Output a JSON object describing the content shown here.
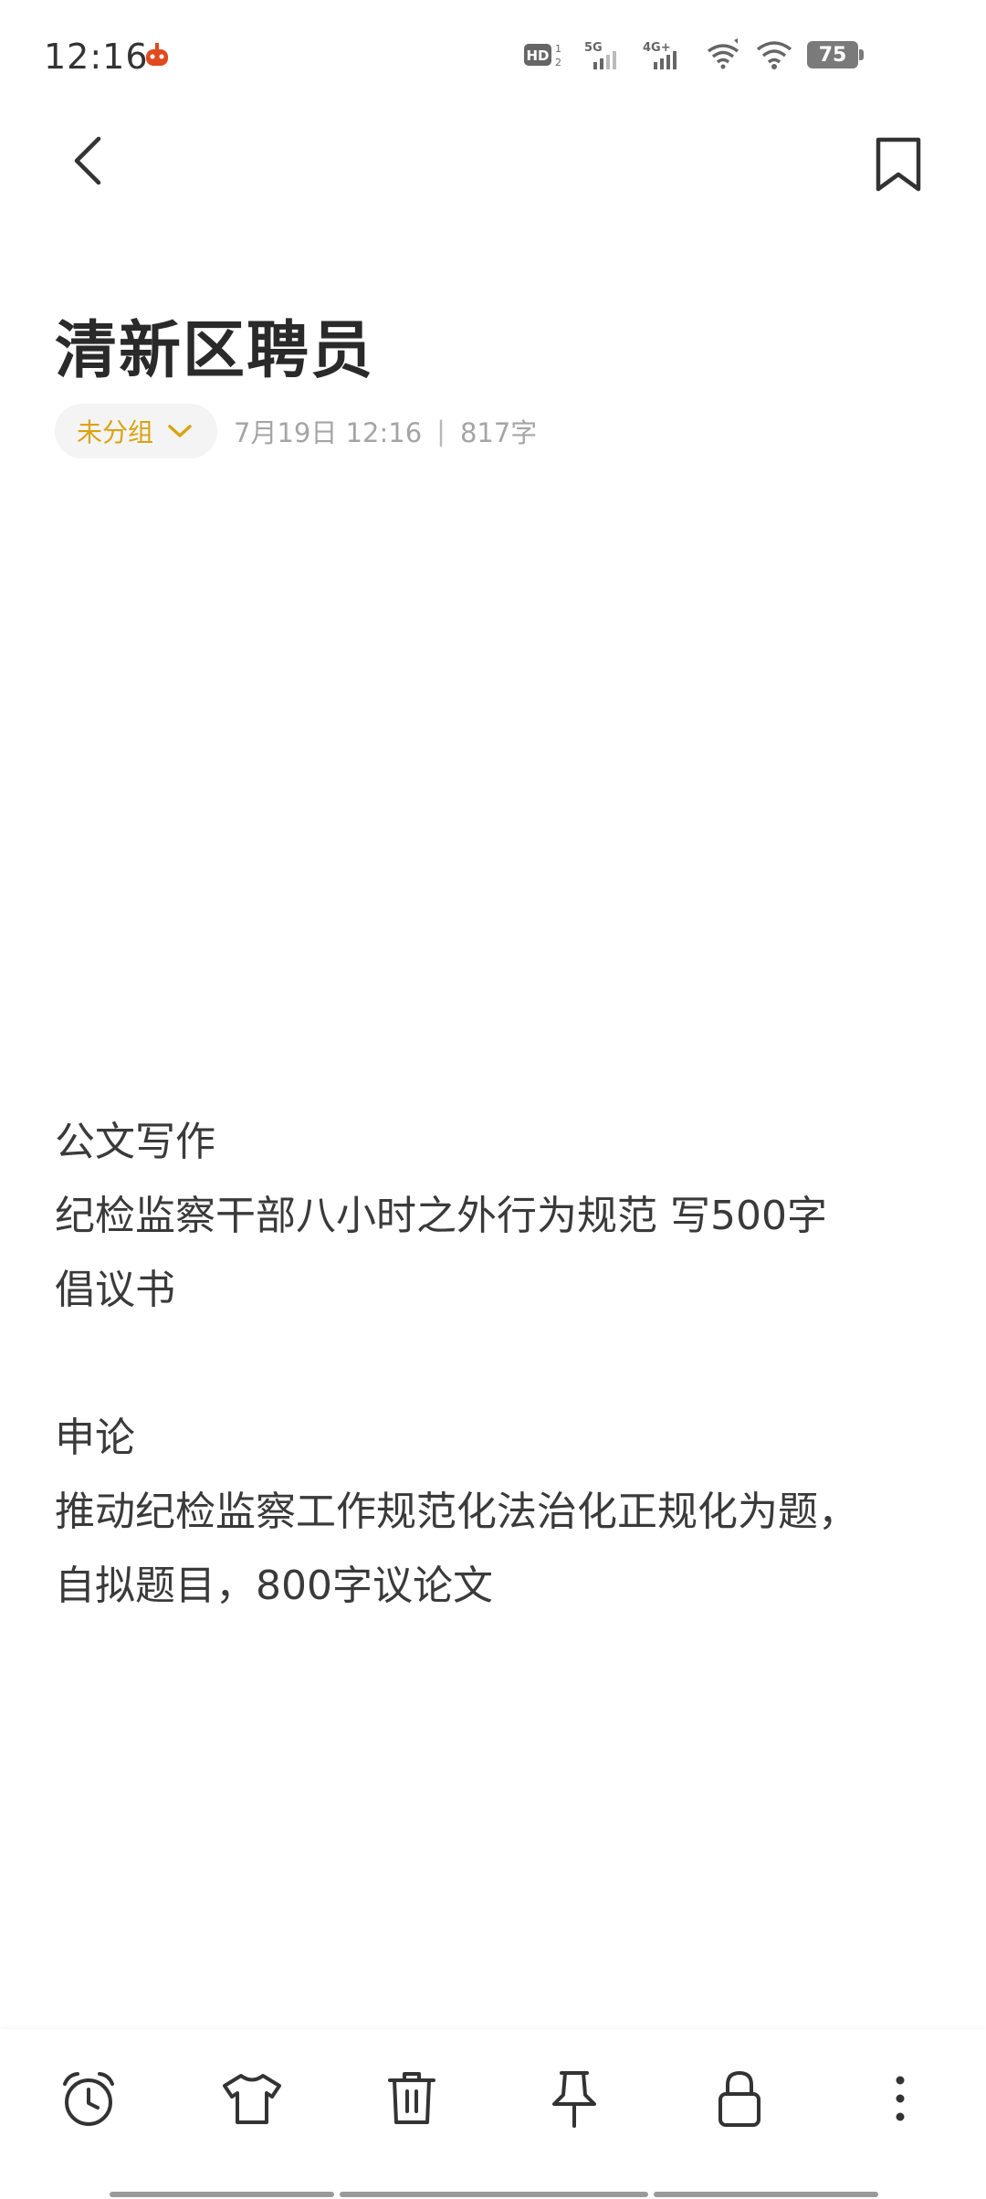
{
  "status_bar": {
    "time": "12:16",
    "signal_label_5g": "5G",
    "signal_label_4g": "4G+",
    "hd_label": "HD",
    "battery": "75"
  },
  "note": {
    "title": "清新区聘员",
    "group_label": "未分组",
    "date": "7月19日 12:16",
    "separator": "|",
    "word_count": "817字",
    "body": {
      "section1_heading": "公文写作",
      "section1_line1": "纪检监察干部八小时之外行为规范 写500字",
      "section1_line2": "倡议书",
      "section2_heading": "申论",
      "section2_line1": "推动纪检监察工作规范化法治化正规化为题，",
      "section2_line2": "自拟题目，800字议论文"
    }
  },
  "colors": {
    "accent": "#d9a412",
    "text": "#2b2b2b",
    "meta": "#a5a5a5",
    "icon": "#333333"
  },
  "icons": {
    "back": "back-arrow-icon",
    "bookmark": "bookmark-icon",
    "alarm": "alarm-clock-icon",
    "theme": "shirt-icon",
    "delete": "trash-icon",
    "pin": "pin-icon",
    "lock": "lock-icon",
    "more": "more-vertical-icon"
  }
}
